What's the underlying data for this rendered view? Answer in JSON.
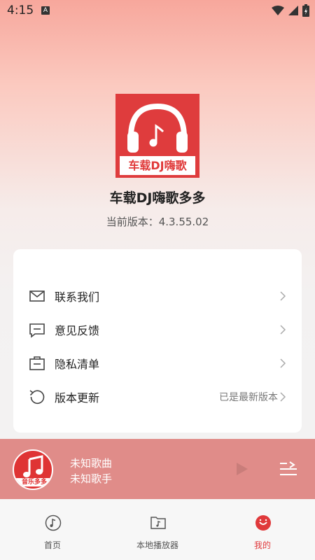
{
  "status_bar": {
    "time": "4:15",
    "badge": "A"
  },
  "app": {
    "logo_text": "车载DJ嗨歌",
    "name": "车载DJ嗨歌多多",
    "version": "当前版本：4.3.55.02"
  },
  "menu": [
    {
      "icon": "mail-icon",
      "label": "联系我们",
      "value": ""
    },
    {
      "icon": "feedback-icon",
      "label": "意见反馈",
      "value": ""
    },
    {
      "icon": "privacy-list-icon",
      "label": "隐私清单",
      "value": ""
    },
    {
      "icon": "refresh-icon",
      "label": "版本更新",
      "value": "已是最新版本"
    }
  ],
  "player": {
    "cover_text": "音乐多多",
    "title": "未知歌曲",
    "artist": "未知歌手"
  },
  "nav": [
    {
      "icon": "music-note-icon",
      "label": "首页",
      "active": false
    },
    {
      "icon": "folder-music-icon",
      "label": "本地播放器",
      "active": false
    },
    {
      "icon": "smile-icon",
      "label": "我的",
      "active": true
    }
  ],
  "colors": {
    "accent": "#e0393b",
    "player_bg": "#e08c89",
    "logo_red": "#df3c3d"
  }
}
